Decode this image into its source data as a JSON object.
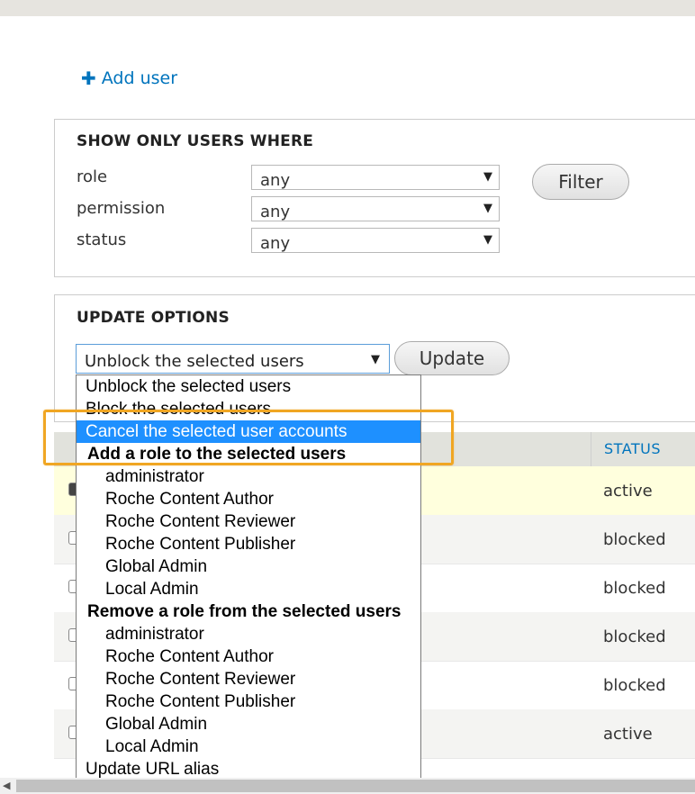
{
  "add_user": {
    "icon": "plus-icon",
    "label": "Add user"
  },
  "filter": {
    "title": "SHOW ONLY USERS WHERE",
    "fields": [
      {
        "label": "role",
        "value": "any"
      },
      {
        "label": "permission",
        "value": "any"
      },
      {
        "label": "status",
        "value": "any"
      }
    ],
    "button": "Filter"
  },
  "update": {
    "title": "UPDATE OPTIONS",
    "selected": "Unblock the selected users",
    "button": "Update"
  },
  "table": {
    "status_header": "STATUS",
    "rows": [
      {
        "status": "active",
        "checked": true
      },
      {
        "status": "blocked",
        "checked": false
      },
      {
        "status": "blocked",
        "checked": false
      },
      {
        "status": "blocked",
        "checked": false
      },
      {
        "status": "blocked",
        "checked": false
      },
      {
        "status": "active",
        "checked": false
      }
    ]
  },
  "dropdown": {
    "options": [
      {
        "label": "Unblock the selected users",
        "kind": "option"
      },
      {
        "label": "Block the selected users",
        "kind": "option"
      },
      {
        "label": "Cancel the selected user accounts",
        "kind": "option",
        "active": true
      },
      {
        "label": "Add a role to the selected users",
        "kind": "group"
      },
      {
        "label": "administrator",
        "kind": "sub"
      },
      {
        "label": "Roche Content Author",
        "kind": "sub"
      },
      {
        "label": "Roche Content Reviewer",
        "kind": "sub"
      },
      {
        "label": "Roche Content Publisher",
        "kind": "sub"
      },
      {
        "label": "Global Admin",
        "kind": "sub"
      },
      {
        "label": "Local Admin",
        "kind": "sub"
      },
      {
        "label": "Remove a role from the selected users",
        "kind": "group"
      },
      {
        "label": "administrator",
        "kind": "sub"
      },
      {
        "label": "Roche Content Author",
        "kind": "sub"
      },
      {
        "label": "Roche Content Reviewer",
        "kind": "sub"
      },
      {
        "label": "Roche Content Publisher",
        "kind": "sub"
      },
      {
        "label": "Global Admin",
        "kind": "sub"
      },
      {
        "label": "Local Admin",
        "kind": "sub"
      },
      {
        "label": "Update URL alias",
        "kind": "option"
      }
    ]
  },
  "colors": {
    "link": "#0074bd",
    "highlight": "#f0a623",
    "active_option": "#1e90ff",
    "selected_row": "#ffffdd"
  }
}
